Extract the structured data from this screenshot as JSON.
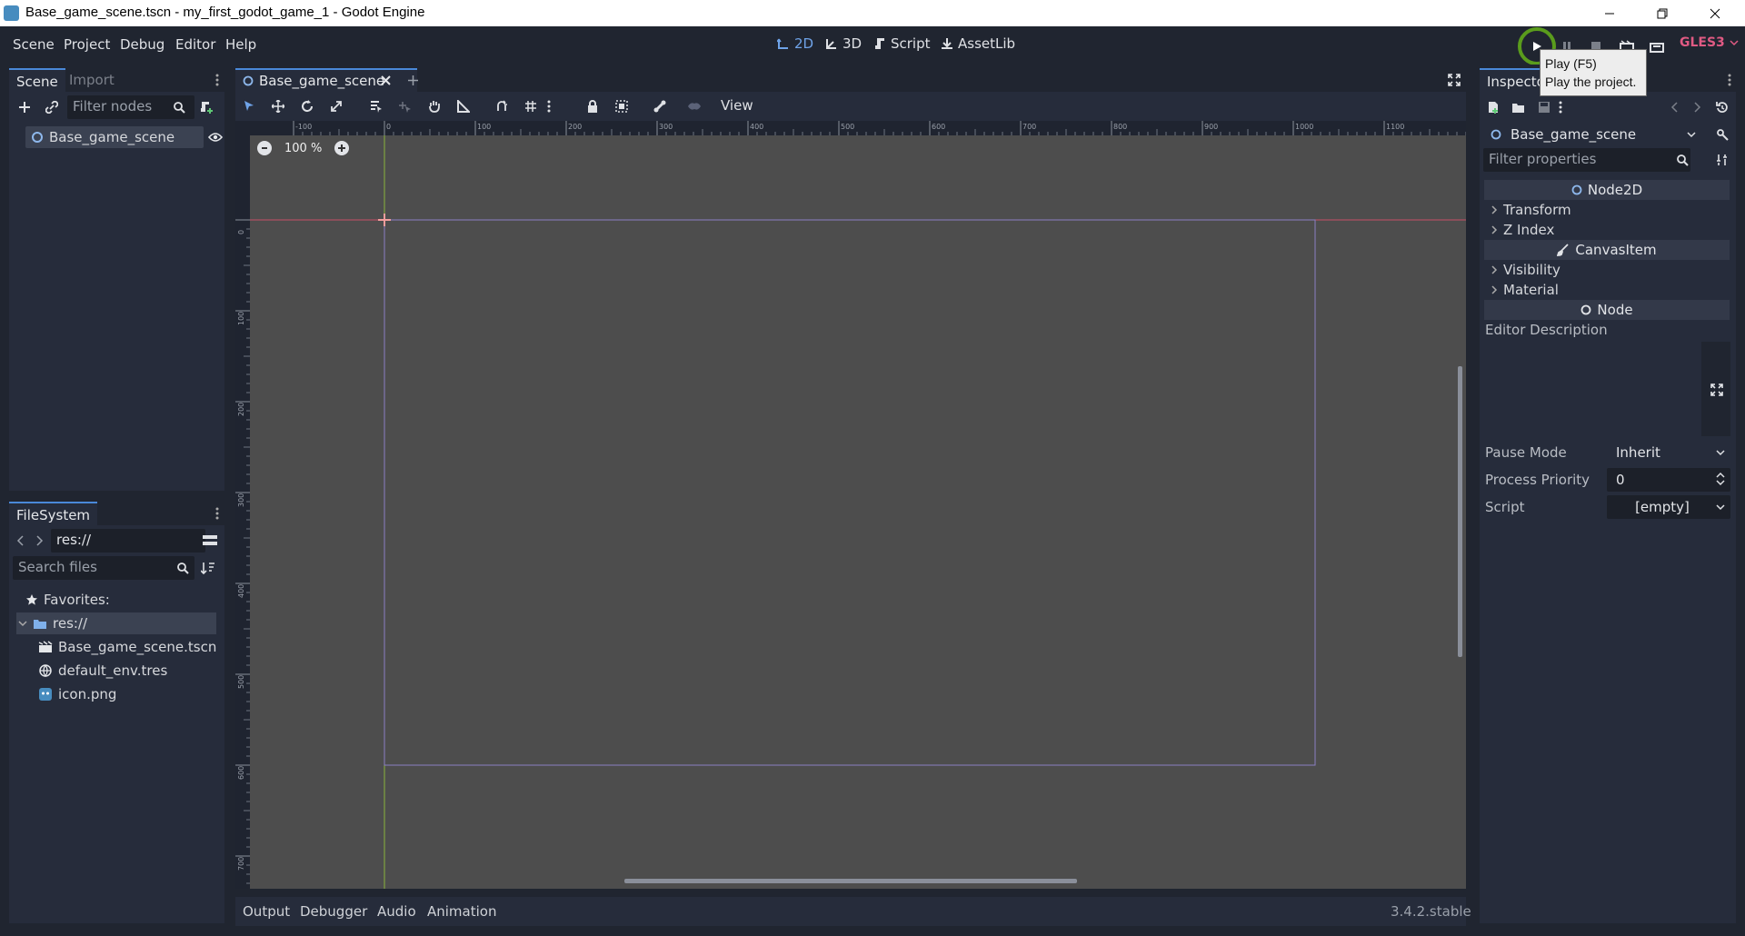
{
  "window": {
    "title": "Base_game_scene.tscn - my_first_godot_game_1 - Godot Engine"
  },
  "menu": [
    "Scene",
    "Project",
    "Debug",
    "Editor",
    "Help"
  ],
  "workspaces": [
    {
      "label": "2D",
      "active": true
    },
    {
      "label": "3D",
      "active": false
    },
    {
      "label": "Script",
      "active": false
    },
    {
      "label": "AssetLib",
      "active": false
    }
  ],
  "renderer": "GLES3",
  "tooltip": {
    "line1": "Play (F5)",
    "line2": "Play the project."
  },
  "scene_dock": {
    "tabs": [
      "Scene",
      "Import"
    ],
    "filter_placeholder": "Filter nodes",
    "root_node": "Base_game_scene"
  },
  "filesystem_dock": {
    "title": "FileSystem",
    "path": "res://",
    "search_placeholder": "Search files",
    "favorites_label": "Favorites:",
    "root": "res://",
    "files": [
      "Base_game_scene.tscn",
      "default_env.tres",
      "icon.png"
    ]
  },
  "editor": {
    "scene_tab": "Base_game_scene",
    "zoom": "100 %",
    "view_menu": "View",
    "ruler_h_labels": [
      "-100",
      "0",
      "100",
      "200",
      "300",
      "400",
      "500",
      "600",
      "700",
      "800",
      "900",
      "1000",
      "1100"
    ],
    "ruler_v_labels": [
      "0",
      "100",
      "200",
      "300",
      "400",
      "500",
      "600",
      "700"
    ]
  },
  "inspector": {
    "title": "Inspector",
    "node_name": "Base_game_scene",
    "filter_placeholder": "Filter properties",
    "sections": {
      "node2d": "Node2D",
      "transform": "Transform",
      "zindex": "Z Index",
      "canvasitem": "CanvasItem",
      "visibility": "Visibility",
      "material": "Material",
      "node": "Node"
    },
    "editor_description_label": "Editor Description",
    "pause_mode_label": "Pause Mode",
    "pause_mode_value": "Inherit",
    "process_priority_label": "Process Priority",
    "process_priority_value": "0",
    "script_label": "Script",
    "script_value": "[empty]"
  },
  "bottom_panel": {
    "tabs": [
      "Output",
      "Debugger",
      "Audio",
      "Animation"
    ],
    "version": "3.4.2.stable"
  },
  "colors": {
    "accent": "#4a88d8",
    "play_highlight": "#5a9c1c",
    "renderer": "#e05a83"
  }
}
